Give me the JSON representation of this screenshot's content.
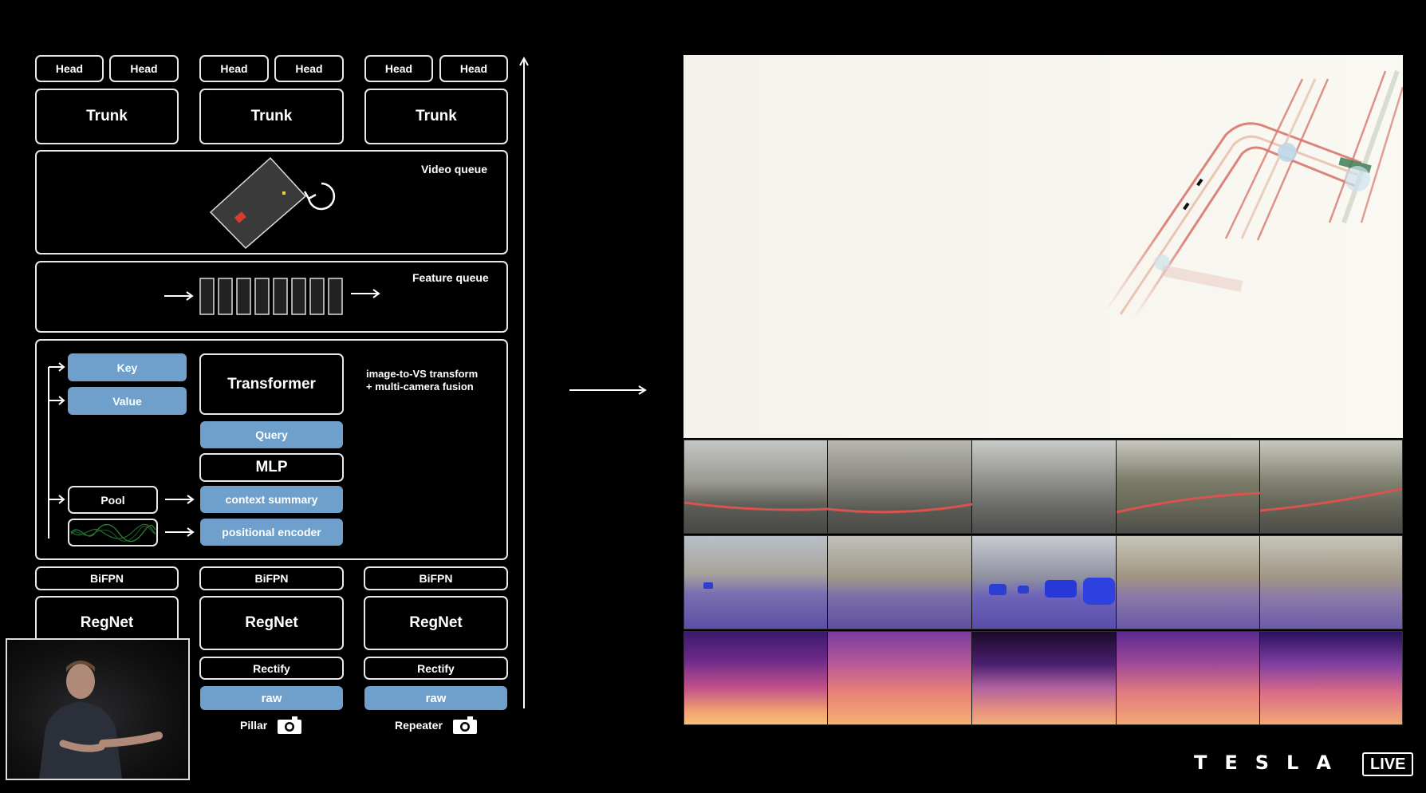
{
  "heads": [
    "Head",
    "Head",
    "Head",
    "Head",
    "Head",
    "Head"
  ],
  "trunks": [
    "Trunk",
    "Trunk",
    "Trunk"
  ],
  "video_queue": {
    "label": "Video queue"
  },
  "feature_queue": {
    "label": "Feature queue",
    "slots": 8
  },
  "fusion": {
    "key": "Key",
    "value": "Value",
    "transformer": "Transformer",
    "caption_line1": "image-to-VS transform",
    "caption_line2": "+ multi-camera fusion",
    "query": "Query",
    "mlp": "MLP",
    "pool": "Pool",
    "context_summary": "context summary",
    "positional_encoder": "positional encoder"
  },
  "bifpn": [
    "BiFPN",
    "BiFPN",
    "BiFPN"
  ],
  "regnet": [
    "RegNet",
    "RegNet",
    "RegNet"
  ],
  "rectify": [
    "Rectify",
    "Rectify"
  ],
  "raw": [
    "raw",
    "raw"
  ],
  "cameras": [
    "Pillar",
    "Repeater"
  ],
  "brand": {
    "logo": "TESLA",
    "live": "LIVE"
  },
  "colors": {
    "accent_blue": "#6fa0cc",
    "background": "#000000",
    "stroke": "#e8e8e8"
  }
}
